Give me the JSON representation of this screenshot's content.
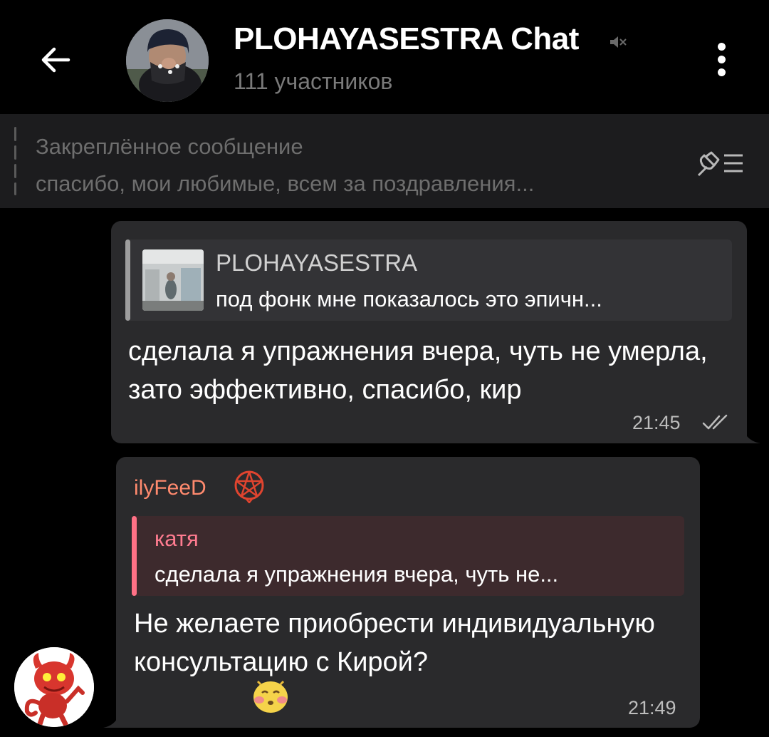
{
  "header": {
    "title": "PLOHAYASESTRA Chat",
    "subtitle": "111 участников",
    "icons": [
      "back-arrow-icon",
      "muted-icon",
      "more-vertical-icon"
    ]
  },
  "pinned": {
    "title": "Закреплённое сообщение",
    "text": "спасибо, мои любимые, всем за поздравления...",
    "icon": "pinned-list-icon"
  },
  "messages": [
    {
      "direction": "outgoing",
      "reply": {
        "name": "PLOHAYASESTRA",
        "text": "под фонк мне показалось это эпичн..."
      },
      "text": "сделала я упражнения вчера, чуть не умерла, зато эффективно, спасибо, кир",
      "time": "21:45",
      "status": "read"
    },
    {
      "direction": "incoming",
      "sender": "ilyFeeD",
      "reply": {
        "name": "катя",
        "text": "сделала я упражнения вчера, чуть не..."
      },
      "text": "Не желаете приобрести индивидуальную консультацию с Кирой?",
      "time": "21:49"
    }
  ],
  "colors": {
    "background": "#000000",
    "bubble": "#2a2a2c",
    "pinned_bar": "#1c1c1e",
    "sender_name": "#ff8a6e",
    "reply_accent": "#ff7186",
    "muted_text": "#6e6e6e"
  }
}
